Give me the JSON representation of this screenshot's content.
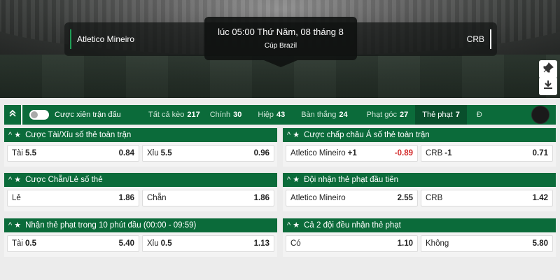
{
  "match": {
    "home_team": "Atletico Mineiro",
    "away_team": "CRB",
    "kick_off": "lúc 05:00 Thứ Năm, 08 tháng 8",
    "league": "Cúp Brazil"
  },
  "side_buttons": [
    "pin-icon",
    "download-icon"
  ],
  "market_bar": {
    "parlay_label": "Cược xiên trận đấu",
    "tabs": [
      {
        "label": "Tất cả kèo",
        "count": "217"
      },
      {
        "label": "Chính",
        "count": "30"
      },
      {
        "label": "Hiệp",
        "count": "43"
      },
      {
        "label": "Bàn thắng",
        "count": "24"
      },
      {
        "label": "Phạt góc",
        "count": "27"
      },
      {
        "label": "Thẻ phạt",
        "count": "7"
      },
      {
        "label": "Đ",
        "count": ""
      }
    ],
    "active_tab": "Thẻ phạt"
  },
  "panels": [
    {
      "title": "Cược Tài/Xỉu số thẻ toàn trận",
      "odds": [
        {
          "label": "Tài",
          "line": "5.5",
          "price": "0.84"
        },
        {
          "label": "Xỉu",
          "line": "5.5",
          "price": "0.96"
        }
      ]
    },
    {
      "title": "Cược chấp châu Á số thẻ toàn trận",
      "odds": [
        {
          "label": "Atletico Mineiro",
          "line": "+1",
          "price": "-0.89"
        },
        {
          "label": "CRB",
          "line": "-1",
          "price": "0.71"
        }
      ]
    },
    {
      "title": "Cược Chẵn/Lẻ số thẻ",
      "odds": [
        {
          "label": "Lẻ",
          "line": "",
          "price": "1.86"
        },
        {
          "label": "Chẵn",
          "line": "",
          "price": "1.86"
        }
      ]
    },
    {
      "title": "Đội nhận thẻ phạt đầu tiên",
      "odds": [
        {
          "label": "Atletico Mineiro",
          "line": "",
          "price": "2.55"
        },
        {
          "label": "CRB",
          "line": "",
          "price": "1.42"
        }
      ]
    },
    {
      "title": "Nhận thẻ phạt trong 10 phút đầu (00:00 - 09:59)",
      "odds": [
        {
          "label": "Tài",
          "line": "0.5",
          "price": "5.40"
        },
        {
          "label": "Xỉu",
          "line": "0.5",
          "price": "1.13"
        }
      ]
    },
    {
      "title": "Cả 2 đội đều nhận thẻ phạt",
      "odds": [
        {
          "label": "Có",
          "line": "",
          "price": "1.10"
        },
        {
          "label": "Không",
          "line": "",
          "price": "5.80"
        }
      ]
    }
  ],
  "colors": {
    "brand_green": "#0b6b3a",
    "negative": "#d32a2a"
  }
}
